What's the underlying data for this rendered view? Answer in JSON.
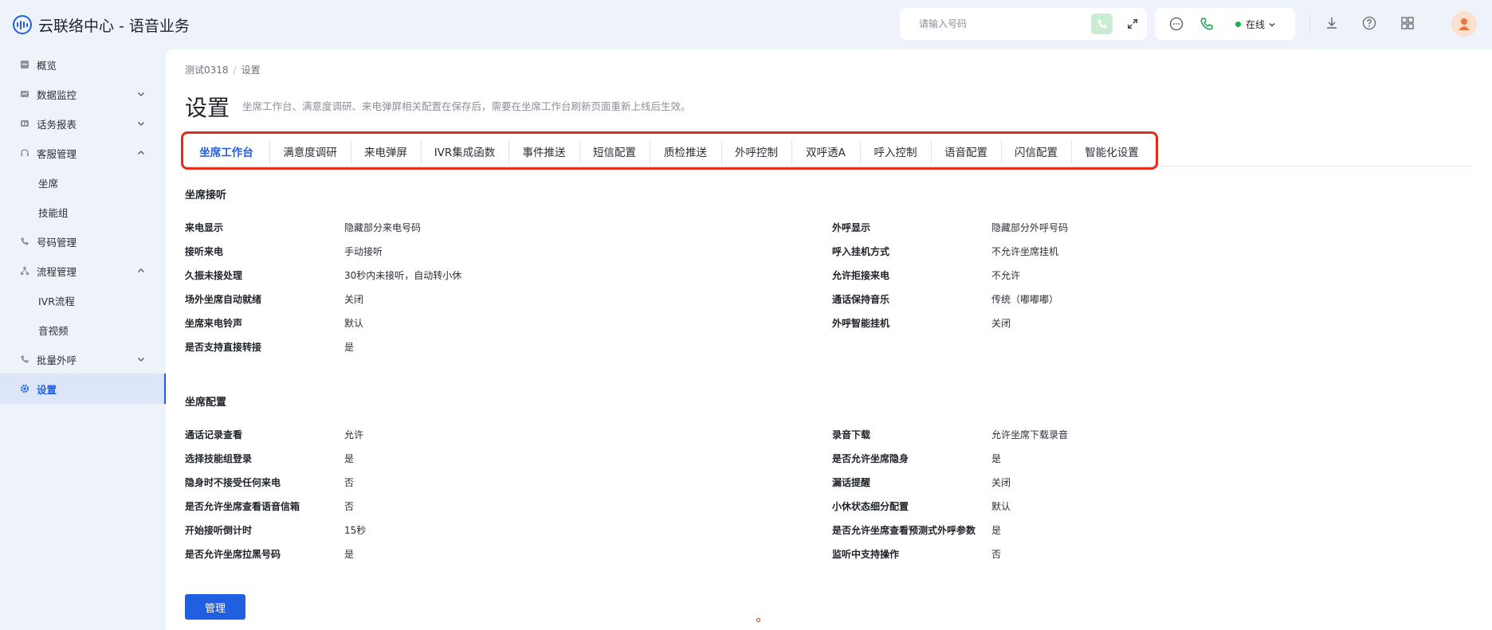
{
  "app": {
    "title": "云联络中心 - 语音业务"
  },
  "search": {
    "placeholder": "请输入号码"
  },
  "status": {
    "online": "在线"
  },
  "sidebar": {
    "items": [
      {
        "label": "概览",
        "icon": "overview-icon"
      },
      {
        "label": "数据监控",
        "icon": "monitor-icon"
      },
      {
        "label": "话务报表",
        "icon": "report-icon"
      },
      {
        "label": "客服管理",
        "icon": "headset-icon"
      },
      {
        "label": "坐席"
      },
      {
        "label": "技能组"
      },
      {
        "label": "号码管理",
        "icon": "phone-icon"
      },
      {
        "label": "流程管理",
        "icon": "flow-icon"
      },
      {
        "label": "IVR流程"
      },
      {
        "label": "音视频"
      },
      {
        "label": "批量外呼",
        "icon": "batch-call-icon"
      },
      {
        "label": "设置",
        "icon": "gear-icon"
      }
    ]
  },
  "breadcrumb": {
    "parent": "测试0318",
    "sep": "/",
    "current": "设置"
  },
  "page": {
    "title": "设置",
    "description": "坐席工作台、满意度调研、来电弹屏相关配置在保存后，需要在坐席工作台刷新页面重新上线后生效。"
  },
  "tabs": [
    "坐席工作台",
    "满意度调研",
    "来电弹屏",
    "IVR集成函数",
    "事件推送",
    "短信配置",
    "质检推送",
    "外呼控制",
    "双呼透A",
    "呼入控制",
    "语音配置",
    "闪信配置",
    "智能化设置"
  ],
  "section1": {
    "title": "坐席接听",
    "left": [
      {
        "label": "来电显示",
        "value": "隐藏部分来电号码"
      },
      {
        "label": "接听来电",
        "value": "手动接听"
      },
      {
        "label": "久振未接处理",
        "value": "30秒内未接听，自动转小休"
      },
      {
        "label": "场外坐席自动就绪",
        "value": "关闭"
      },
      {
        "label": "坐席来电铃声",
        "value": "默认"
      },
      {
        "label": "是否支持直接转接",
        "value": "是"
      }
    ],
    "right": [
      {
        "label": "外呼显示",
        "value": "隐藏部分外呼号码"
      },
      {
        "label": "呼入挂机方式",
        "value": "不允许坐席挂机"
      },
      {
        "label": "允许拒接来电",
        "value": "不允许"
      },
      {
        "label": "通话保持音乐",
        "value": "传统（嘟嘟嘟）"
      },
      {
        "label": "外呼智能挂机",
        "value": "关闭"
      }
    ]
  },
  "section2": {
    "title": "坐席配置",
    "left": [
      {
        "label": "通话记录查看",
        "value": "允许"
      },
      {
        "label": "选择技能组登录",
        "value": "是"
      },
      {
        "label": "隐身时不接受任何来电",
        "value": "否"
      },
      {
        "label": "是否允许坐席查看语音信箱",
        "value": "否"
      },
      {
        "label": "开始接听倒计时",
        "value": "15秒"
      },
      {
        "label": "是否允许坐席拉黑号码",
        "value": "是"
      }
    ],
    "right": [
      {
        "label": "录音下载",
        "value": "允许坐席下载录音"
      },
      {
        "label": "是否允许坐席隐身",
        "value": "是"
      },
      {
        "label": "漏话提醒",
        "value": "关闭"
      },
      {
        "label": "小休状态细分配置",
        "value": "默认"
      },
      {
        "label": "是否允许坐席查看预测式外呼参数",
        "value": "是"
      },
      {
        "label": "监听中支持操作",
        "value": "否"
      }
    ]
  },
  "actions": {
    "manage": "管理"
  },
  "colors": {
    "accent": "#1f5fe0",
    "highlight": "#e02d1c",
    "online": "#16b34a"
  }
}
